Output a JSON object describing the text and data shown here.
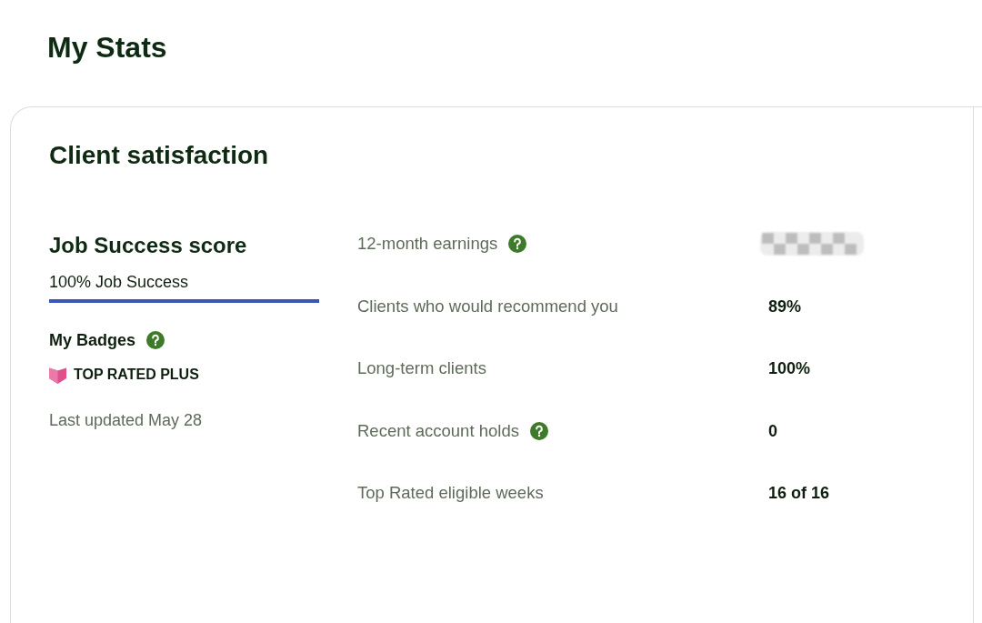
{
  "page": {
    "title": "My Stats"
  },
  "card": {
    "title": "Client satisfaction",
    "job_success": {
      "heading": "Job Success score",
      "label": "100% Job Success",
      "level": 1
    },
    "badges": {
      "heading": "My Badges",
      "help": true,
      "items": [
        {
          "label": "TOP RATED PLUS"
        }
      ]
    },
    "last_updated": "Last updated May 28",
    "stats": [
      {
        "label": "12-month earnings",
        "help": true,
        "kind": "blurred"
      },
      {
        "label": "Clients who would recommend you",
        "help": false,
        "kind": "text",
        "value": "89%"
      },
      {
        "label": "Long-term clients",
        "help": false,
        "kind": "text",
        "value": "100%"
      },
      {
        "label": "Recent account holds",
        "help": true,
        "kind": "text",
        "value": "0"
      },
      {
        "label": "Top Rated eligible weeks",
        "help": false,
        "kind": "text",
        "value": "16 of 16"
      }
    ]
  }
}
